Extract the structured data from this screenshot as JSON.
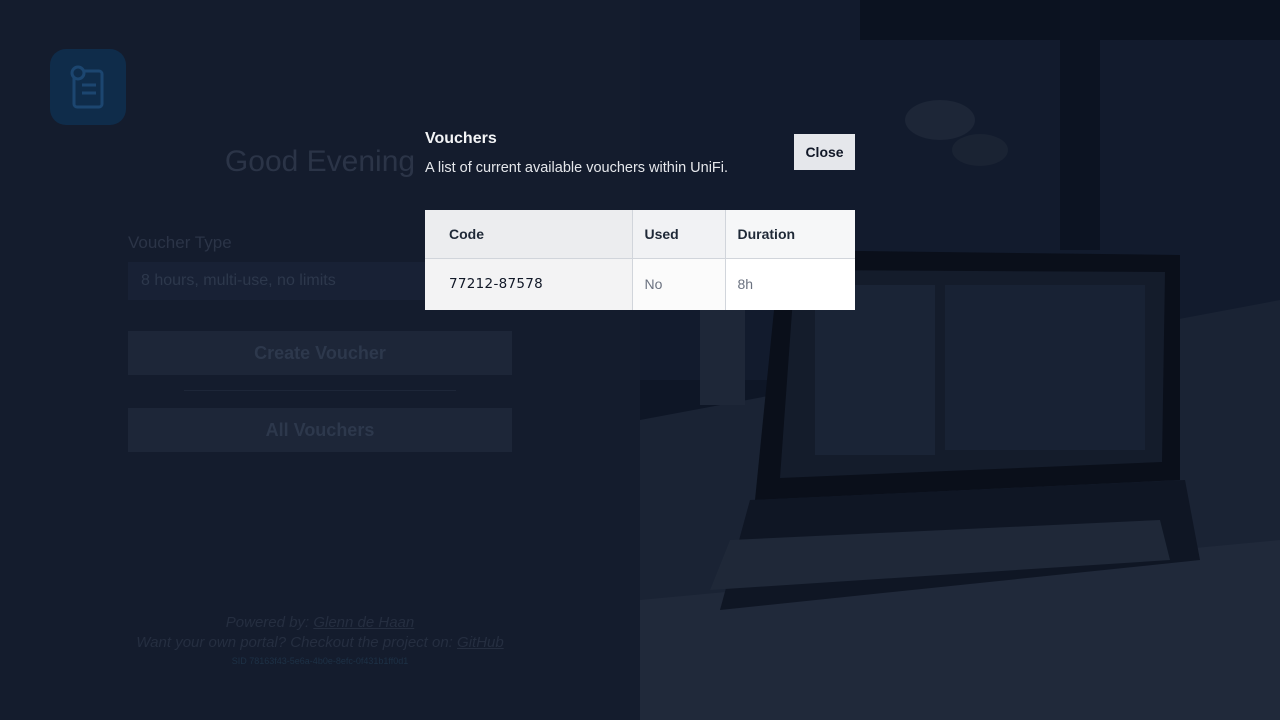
{
  "page": {
    "greeting": "Good Evening",
    "voucher_type_label": "Voucher Type",
    "voucher_type_value": "8 hours, multi-use, no limits",
    "create_button": "Create Voucher",
    "all_vouchers_button": "All Vouchers",
    "footer": {
      "powered_prefix": "Powered by: ",
      "author_link": "Glenn de Haan",
      "portal_prefix": "Want your own portal? Checkout the project on: ",
      "github_link": "GitHub",
      "build_id": "SID 78163f43-5e6a-4b0e-8efc-0f431b1ff0d1"
    }
  },
  "modal": {
    "title": "Vouchers",
    "description": "A list of current available vouchers within UniFi.",
    "close_label": "Close",
    "table": {
      "headers": [
        "Code",
        "Used",
        "Duration"
      ],
      "rows": [
        {
          "code": "77212-87578",
          "used": "No",
          "duration": "8h"
        }
      ]
    }
  },
  "colors": {
    "overlay": "#111a2b",
    "logo_bg": "#0f2c4a",
    "close_button_bg": "#e5e7eb"
  }
}
